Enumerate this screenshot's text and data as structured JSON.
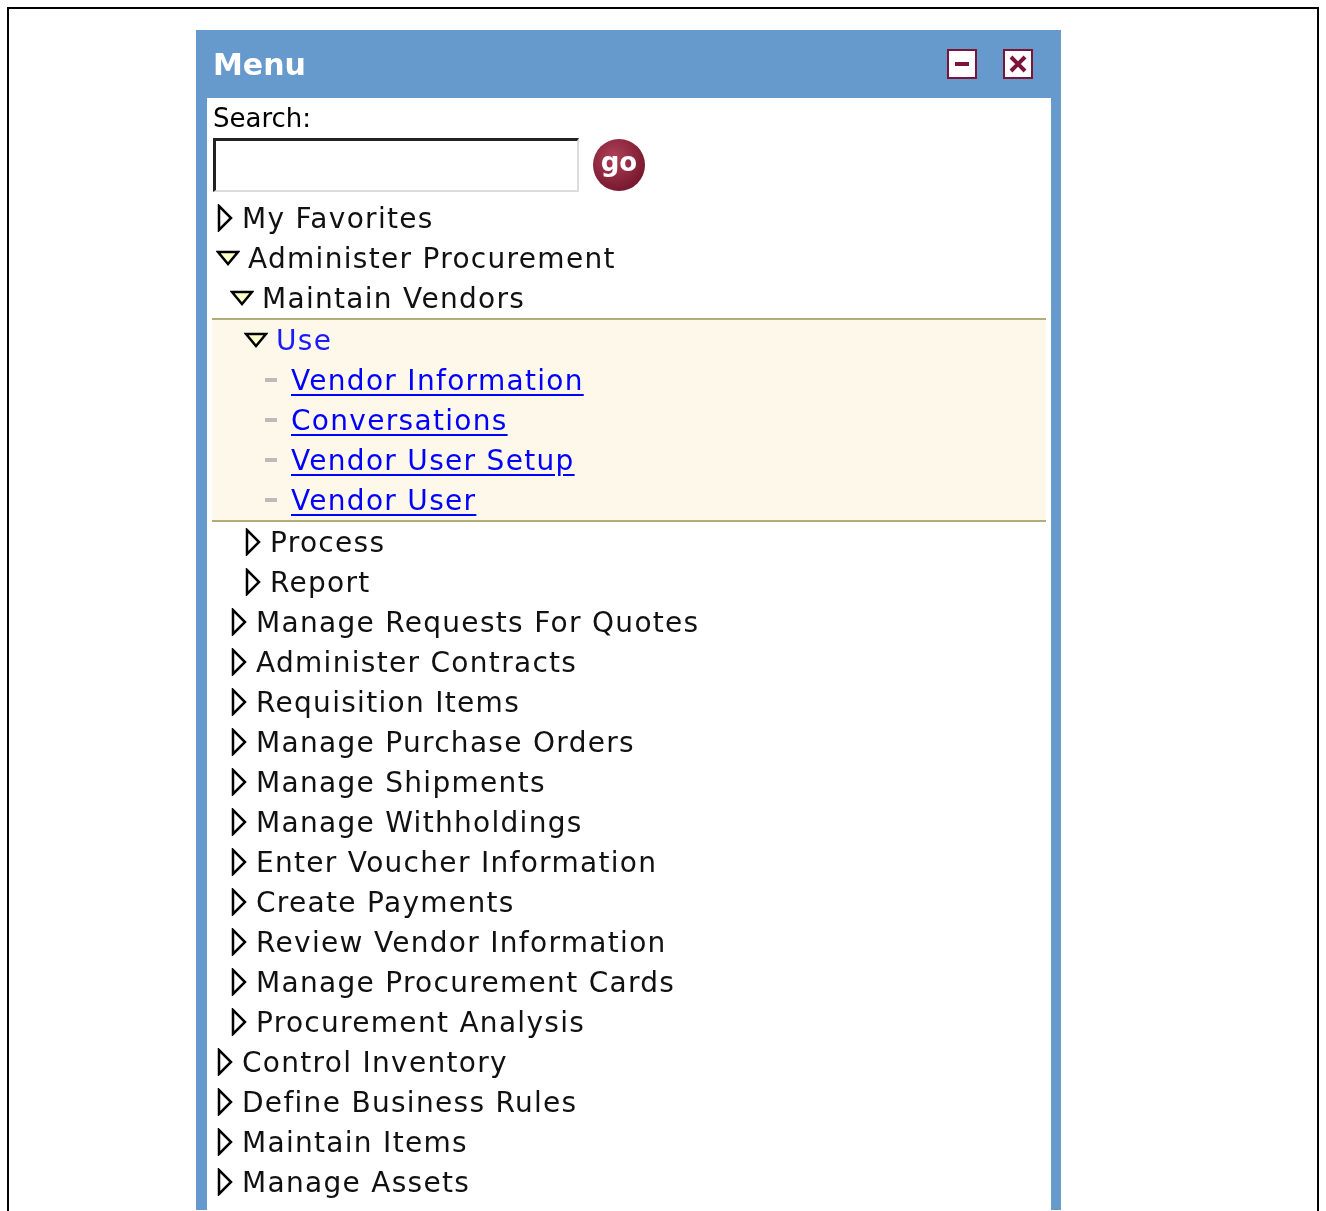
{
  "panel": {
    "title": "Menu",
    "buttons": [
      {
        "kind": "minimize"
      },
      {
        "kind": "close"
      }
    ]
  },
  "search": {
    "label": "Search:",
    "button": "go"
  },
  "tree": [
    {
      "label": "My Favorites",
      "kind": "folder",
      "expanded": false,
      "selected": false
    },
    {
      "label": "Administer Procurement",
      "kind": "folder",
      "expanded": true,
      "selected": false,
      "children": [
        {
          "label": "Maintain Vendors",
          "kind": "folder",
          "expanded": true,
          "selected": false,
          "children": [
            {
              "label": "Use",
              "kind": "folder",
              "expanded": true,
              "selected": true,
              "children": [
                {
                  "label": "Vendor Information",
                  "kind": "link",
                  "selected": false
                },
                {
                  "label": "Conversations",
                  "kind": "link",
                  "selected": false
                },
                {
                  "label": "Vendor User Setup",
                  "kind": "link",
                  "selected": false
                },
                {
                  "label": "Vendor User",
                  "kind": "link",
                  "selected": false
                }
              ]
            },
            {
              "label": "Process",
              "kind": "folder",
              "expanded": false,
              "selected": false
            },
            {
              "label": "Report",
              "kind": "folder",
              "expanded": false,
              "selected": false
            }
          ]
        },
        {
          "label": "Manage Requests For Quotes",
          "kind": "folder",
          "expanded": false,
          "selected": false
        },
        {
          "label": "Administer Contracts",
          "kind": "folder",
          "expanded": false,
          "selected": false
        },
        {
          "label": "Requisition Items",
          "kind": "folder",
          "expanded": false,
          "selected": false
        },
        {
          "label": "Manage Purchase Orders",
          "kind": "folder",
          "expanded": false,
          "selected": false
        },
        {
          "label": "Manage Shipments",
          "kind": "folder",
          "expanded": false,
          "selected": false
        },
        {
          "label": "Manage Withholdings",
          "kind": "folder",
          "expanded": false,
          "selected": false
        },
        {
          "label": "Enter Voucher Information",
          "kind": "folder",
          "expanded": false,
          "selected": false
        },
        {
          "label": "Create Payments",
          "kind": "folder",
          "expanded": false,
          "selected": false
        },
        {
          "label": "Review Vendor Information",
          "kind": "folder",
          "expanded": false,
          "selected": false
        },
        {
          "label": "Manage Procurement Cards",
          "kind": "folder",
          "expanded": false,
          "selected": false
        },
        {
          "label": "Procurement Analysis",
          "kind": "folder",
          "expanded": false,
          "selected": false
        }
      ]
    },
    {
      "label": "Control Inventory",
      "kind": "folder",
      "expanded": false,
      "selected": false
    },
    {
      "label": "Define Business Rules",
      "kind": "folder",
      "expanded": false,
      "selected": false
    },
    {
      "label": "Maintain Items",
      "kind": "folder",
      "expanded": false,
      "selected": false
    },
    {
      "label": "Manage Assets",
      "kind": "folder",
      "expanded": false,
      "selected": false
    }
  ]
}
